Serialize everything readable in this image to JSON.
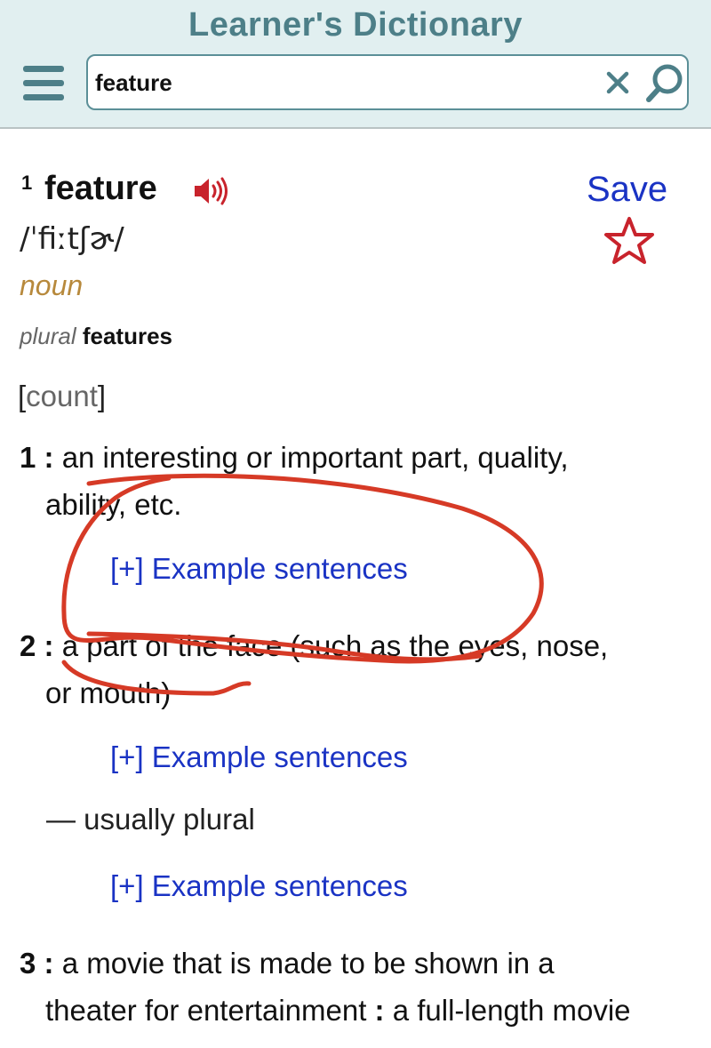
{
  "header": {
    "title": "Learner's Dictionary",
    "menu_icon": "hamburger-menu-icon",
    "search": {
      "value": "feature",
      "placeholder": ""
    },
    "clear_icon": "close-icon",
    "search_icon": "magnifier-icon"
  },
  "entry": {
    "homograph": "1",
    "headword": "feature",
    "audio_icon": "speaker-icon",
    "save_label": "Save",
    "save_icon": "star-outline-icon",
    "pronunciation": "/ˈfiːtʃɚ/",
    "part_of_speech": "noun",
    "plural_label": "plural",
    "plural_form": "features",
    "grammar_open": "[",
    "grammar_label": "count",
    "grammar_close": "]",
    "senses": [
      {
        "num": "1 :",
        "line1": "an interesting or important part, quality,",
        "line2": "ability, etc."
      },
      {
        "num": "2 :",
        "line1": "a part of the face (such as the eyes, nose,",
        "line2": "or mouth)"
      },
      {
        "num": "3 :",
        "line1": "a movie that is made to be shown in a",
        "line2_a": "theater for entertainment",
        "line2_colon": ":",
        "line2_b": "a full-length movie"
      }
    ],
    "example_link": "[+] Example sentences",
    "usage_note": "— usually plural"
  },
  "colors": {
    "header_bg": "#e1eff0",
    "brand": "#4d7f88",
    "link": "#1a33c4",
    "pos": "#b7893c",
    "save_star": "#c8232c",
    "annotation": "#d63a26"
  }
}
